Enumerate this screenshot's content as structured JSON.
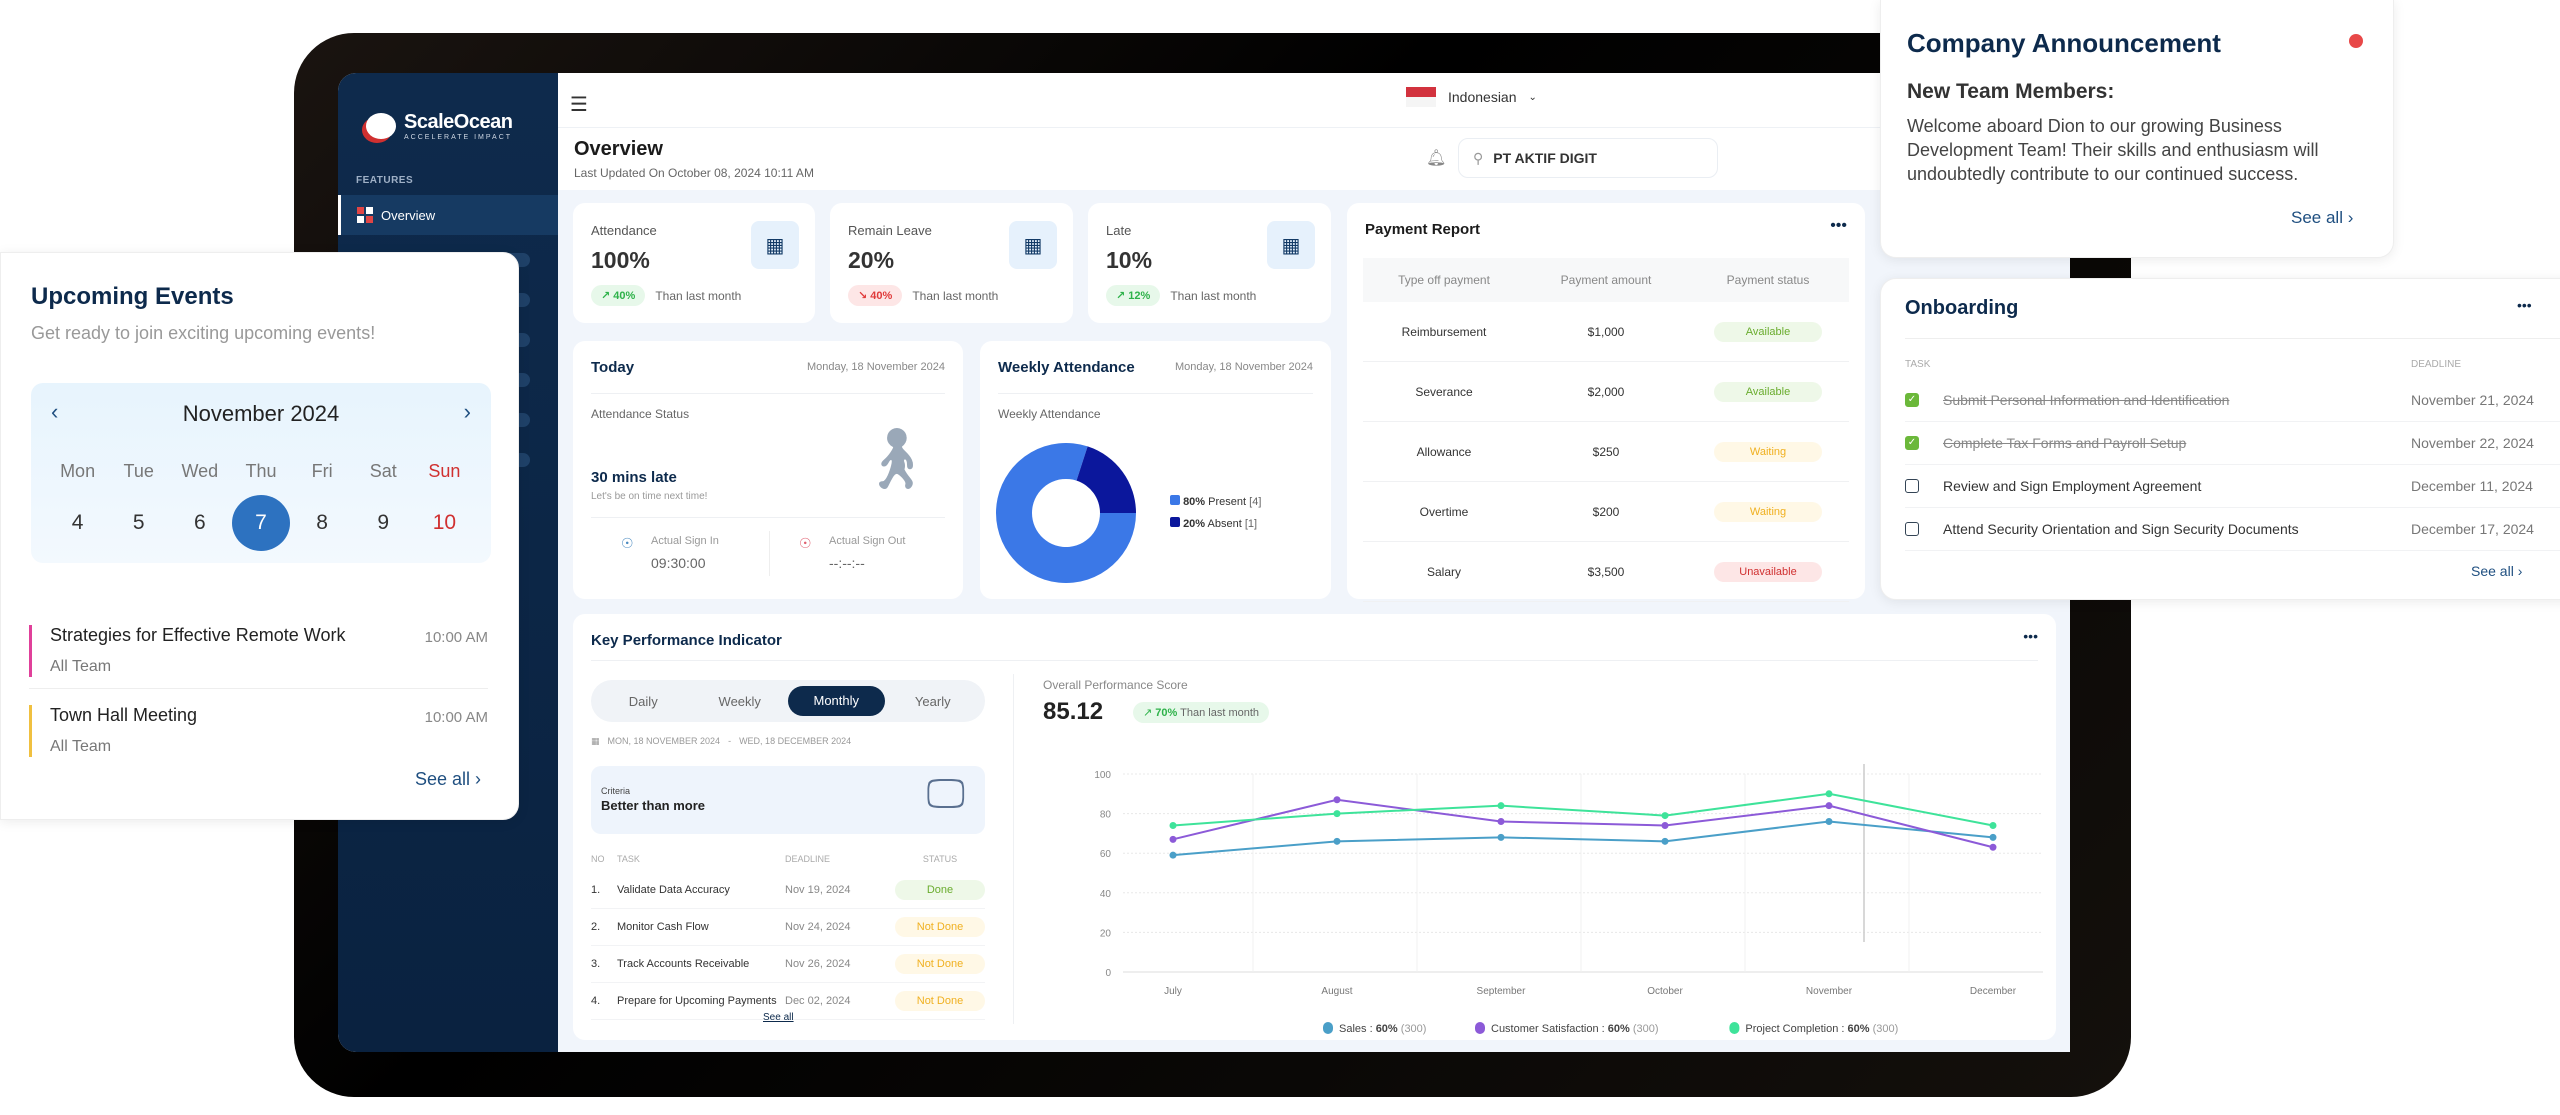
{
  "sidebar": {
    "brand": "ScaleOcean",
    "tagline": "ACCELERATE IMPACT",
    "section": "FEATURES",
    "items": [
      {
        "label": "Overview",
        "icon": "grid-icon",
        "active": true
      }
    ]
  },
  "topbar": {
    "language": "Indonesian",
    "company_search": "PT AKTIF DIGIT"
  },
  "header": {
    "title": "Overview",
    "last_updated": "Last Updated On October 08, 2024 10:11 AM"
  },
  "stats": [
    {
      "label": "Attendance",
      "value": "100%",
      "change": "40%",
      "direction": "up",
      "note": "Than last month"
    },
    {
      "label": "Remain Leave",
      "value": "20%",
      "change": "40%",
      "direction": "down",
      "note": "Than last month"
    },
    {
      "label": "Late",
      "value": "10%",
      "change": "12%",
      "direction": "up",
      "note": "Than last month"
    }
  ],
  "today": {
    "title": "Today",
    "date": "Monday, 18 November 2024",
    "status_label": "Attendance Status",
    "status": "30 mins late",
    "message": "Let's be on time next time!",
    "sign_in_label": "Actual Sign In",
    "sign_in": "09:30:00",
    "sign_out_label": "Actual Sign Out",
    "sign_out": "--:--:--"
  },
  "weekly": {
    "title": "Weekly Attendance",
    "date": "Monday, 18 November 2024",
    "subtitle": "Weekly Attendance",
    "legend": [
      {
        "pct": "80%",
        "label": "Present",
        "count": "[4]",
        "value": 80,
        "color": "#3b78e7"
      },
      {
        "pct": "20%",
        "label": "Absent",
        "count": "[1]",
        "value": 20,
        "color": "#0b179c"
      }
    ]
  },
  "payment": {
    "title": "Payment Report",
    "headers": [
      "Type off payment",
      "Payment amount",
      "Payment status"
    ],
    "rows": [
      {
        "type": "Reimbursement",
        "amount": "$1,000",
        "status": "Available",
        "kind": "av"
      },
      {
        "type": "Severance",
        "amount": "$2,000",
        "status": "Available",
        "kind": "av"
      },
      {
        "type": "Allowance",
        "amount": "$250",
        "status": "Waiting",
        "kind": "wa"
      },
      {
        "type": "Overtime",
        "amount": "$200",
        "status": "Waiting",
        "kind": "wa"
      },
      {
        "type": "Salary",
        "amount": "$3,500",
        "status": "Unavailable",
        "kind": "un"
      }
    ]
  },
  "kpi": {
    "title": "Key Performance Indicator",
    "periods": [
      "Daily",
      "Weekly",
      "Monthly",
      "Yearly"
    ],
    "active_period": "Monthly",
    "range_start": "MON, 18 NOVEMBER 2024",
    "range_sep": "-",
    "range_end": "WED, 18 DECEMBER 2024",
    "criteria_label": "Criteria",
    "criteria": "Better than more",
    "headers": [
      "NO",
      "TASK",
      "DEADLINE",
      "STATUS"
    ],
    "tasks": [
      {
        "no": "1.",
        "task": "Validate Data Accuracy",
        "deadline": "Nov 19, 2024",
        "status": "Done"
      },
      {
        "no": "2.",
        "task": "Monitor Cash Flow",
        "deadline": "Nov 24, 2024",
        "status": "Not Done"
      },
      {
        "no": "3.",
        "task": "Track Accounts Receivable",
        "deadline": "Nov 26, 2024",
        "status": "Not Done"
      },
      {
        "no": "4.",
        "task": "Prepare for Upcoming Payments",
        "deadline": "Dec 02, 2024",
        "status": "Not Done"
      }
    ],
    "see_all": "See all",
    "score_label": "Overall Performance Score",
    "score": "85.12",
    "score_change": "70%",
    "score_note": "Than last month"
  },
  "chart_data": {
    "type": "line",
    "categories": [
      "July",
      "August",
      "September",
      "October",
      "November",
      "December"
    ],
    "ylim": [
      0,
      100
    ],
    "yticks": [
      0,
      20,
      40,
      60,
      80,
      100
    ],
    "grid": true,
    "legend_position": "bottom",
    "series": [
      {
        "name": "Sales",
        "color": "#4a9fc8",
        "values": [
          59,
          66,
          68,
          66,
          76,
          68
        ],
        "legend_pct": "60%",
        "legend_count": "(300)"
      },
      {
        "name": "Customer Satisfaction",
        "color": "#8c5ad8",
        "values": [
          67,
          87,
          76,
          74,
          84,
          63
        ],
        "legend_pct": "60%",
        "legend_count": "(300)"
      },
      {
        "name": "Project Completion",
        "color": "#3ee39a",
        "values": [
          74,
          80,
          84,
          79,
          90,
          74
        ],
        "legend_pct": "60%",
        "legend_count": "(300)"
      }
    ]
  },
  "announcement": {
    "title": "Company Announcement",
    "heading": "New Team Members:",
    "body": "Welcome aboard Dion to our growing Business Development Team! Their skills and enthusiasm will undoubtedly contribute to our continued success.",
    "see_all": "See all"
  },
  "onboarding": {
    "title": "Onboarding",
    "headers": [
      "TASK",
      "DEADLINE"
    ],
    "tasks": [
      {
        "task": "Submit Personal Information and Identification",
        "deadline": "November 21, 2024",
        "done": true
      },
      {
        "task": "Complete Tax Forms and Payroll Setup",
        "deadline": "November 22, 2024",
        "done": true
      },
      {
        "task": "Review and Sign Employment Agreement",
        "deadline": "December 11, 2024",
        "done": false
      },
      {
        "task": "Attend Security Orientation and Sign Security Documents",
        "deadline": "December 17, 2024",
        "done": false
      }
    ],
    "see_all": "See all"
  },
  "events": {
    "title": "Upcoming Events",
    "subtitle": "Get ready to join exciting upcoming events!",
    "month": "November 2024",
    "weekdays": [
      "Mon",
      "Tue",
      "Wed",
      "Thu",
      "Fri",
      "Sat",
      "Sun"
    ],
    "days": [
      "4",
      "5",
      "6",
      "7",
      "8",
      "9",
      "10"
    ],
    "selected": "7",
    "items": [
      {
        "name": "Strategies for Effective Remote Work",
        "group": "All Team",
        "time": "10:00 AM",
        "color": "#e0409a"
      },
      {
        "name": "Town Hall Meeting",
        "group": "All Team",
        "time": "10:00 AM",
        "color": "#f0c040"
      }
    ],
    "see_all": "See all"
  }
}
